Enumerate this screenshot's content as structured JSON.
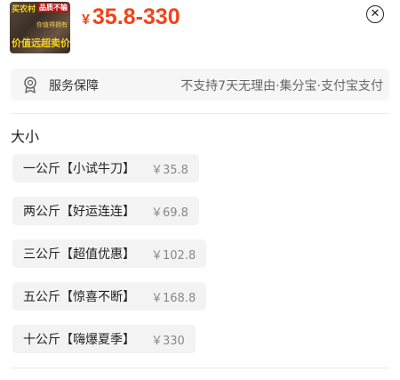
{
  "product": {
    "thumbnail_tag_left": "买农村",
    "thumbnail_tag_right": "品质不输",
    "thumbnail_mid": "你值得拥有",
    "thumbnail_caption": "价值远超卖价",
    "price_symbol": "¥",
    "price_range": "35.8-330"
  },
  "guarantee": {
    "icon": "shield-badge-icon",
    "label": "服务保障",
    "value": "不支持7天无理由·集分宝·支付宝支付"
  },
  "size": {
    "title": "大小",
    "options": [
      {
        "name": "一公斤【小试牛刀】",
        "price": "￥35.8"
      },
      {
        "name": "两公斤【好运连连】",
        "price": "￥69.8"
      },
      {
        "name": "三公斤【超值优惠】",
        "price": "￥102.8"
      },
      {
        "name": "五公斤【惊喜不断】",
        "price": "￥168.8"
      },
      {
        "name": "十公斤【嗨爆夏季】",
        "price": "￥330"
      }
    ]
  },
  "colors": {
    "price": "#f04418",
    "option_bg": "#f3f3f3"
  },
  "close_icon": "close-circle-icon"
}
